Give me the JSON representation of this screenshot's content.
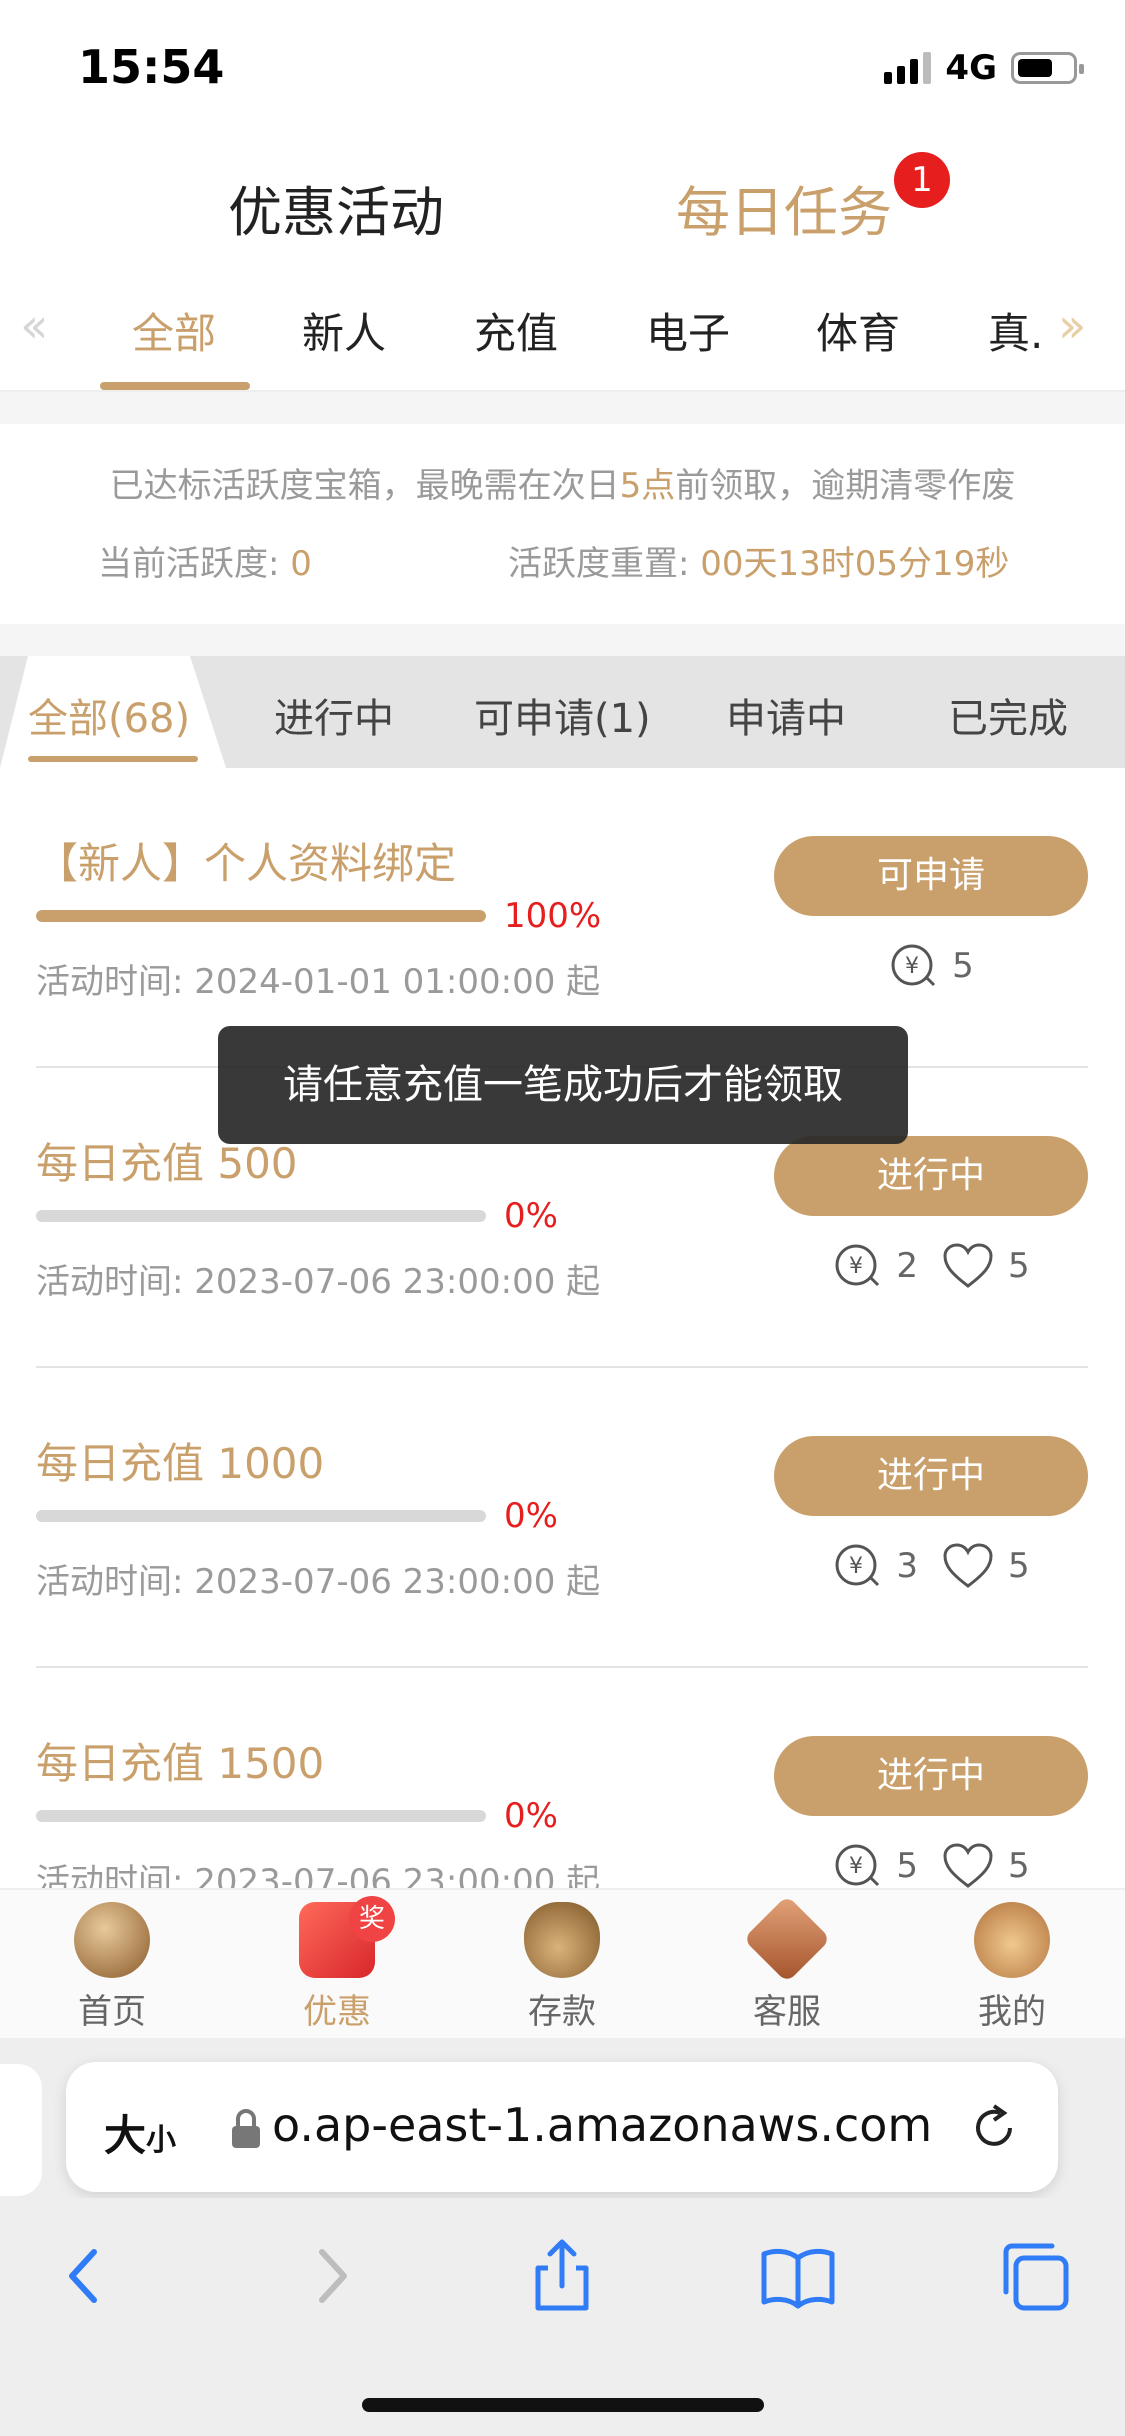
{
  "status": {
    "time": "15:54",
    "network": "4G"
  },
  "top_tabs": {
    "promotions": "优惠活动",
    "daily_tasks": "每日任务",
    "daily_tasks_badge": "1"
  },
  "categories": [
    "全部",
    "新人",
    "充值",
    "电子",
    "体育",
    "真."
  ],
  "notice": {
    "line1_prefix": "已达标活跃度宝箱，最晚需在次日",
    "line1_highlight": "5点",
    "line1_suffix": "前领取，逾期清零作废",
    "activity_label": "当前活跃度: ",
    "activity_value": "0",
    "reset_label": "活跃度重置: ",
    "reset_value": "00天13时05分19秒"
  },
  "filters": [
    "全部(68)",
    "进行中",
    "可申请(1)",
    "申请中",
    "已完成"
  ],
  "tasks": [
    {
      "title": "【新人】个人资料绑定",
      "progress": 100,
      "progress_label": "100%",
      "time": "活动时间: 2024-01-01 01:00:00 起",
      "button": "可申请",
      "yen": "5",
      "heart": ""
    },
    {
      "title": "每日充值 500",
      "progress": 0,
      "progress_label": "0%",
      "time": "活动时间: 2023-07-06 23:00:00 起",
      "button": "进行中",
      "yen": "2",
      "heart": "5"
    },
    {
      "title": "每日充值 1000",
      "progress": 0,
      "progress_label": "0%",
      "time": "活动时间: 2023-07-06 23:00:00 起",
      "button": "进行中",
      "yen": "3",
      "heart": "5"
    },
    {
      "title": "每日充值 1500",
      "progress": 0,
      "progress_label": "0%",
      "time": "活动时间: 2023-07-06 23:00:00 起",
      "button": "进行中",
      "yen": "5",
      "heart": "5"
    }
  ],
  "toast": "请任意充值一笔成功后才能领取",
  "bottom_nav": [
    {
      "label": "首页",
      "icon": "home-ball-icon"
    },
    {
      "label": "优惠",
      "icon": "gift-box-icon",
      "badge": "奖"
    },
    {
      "label": "存款",
      "icon": "money-bag-icon"
    },
    {
      "label": "客服",
      "icon": "fortune-diamond-icon"
    },
    {
      "label": "我的",
      "icon": "lion-mascot-icon"
    }
  ],
  "browser": {
    "text_size_big": "大",
    "text_size_small": "小",
    "url": "o.ap-east-1.amazonaws.com"
  },
  "colors": {
    "accent": "#c9a06b",
    "danger": "#e61e1e",
    "ios_blue": "#2f7cf6"
  }
}
